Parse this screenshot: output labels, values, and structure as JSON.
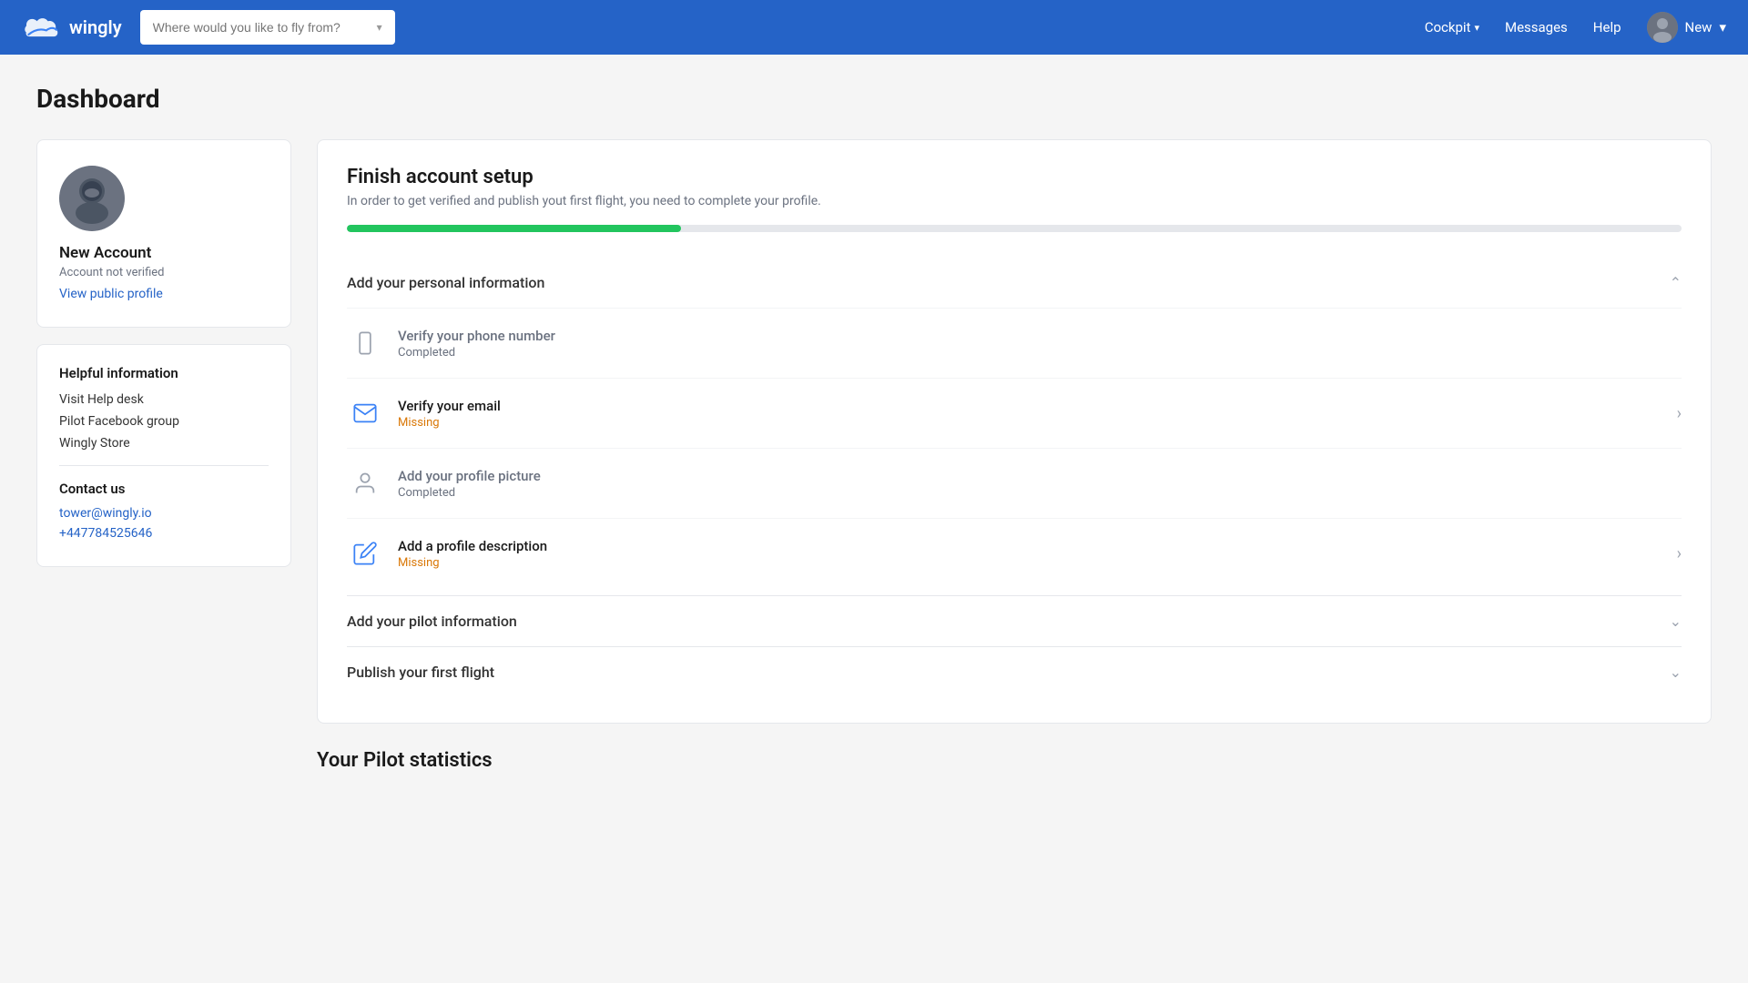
{
  "header": {
    "logo_text": "wingly",
    "search_placeholder": "Where would you like to fly from?",
    "nav_cockpit": "Cockpit",
    "nav_messages": "Messages",
    "nav_help": "Help",
    "nav_new": "New",
    "user_chevron": "▾"
  },
  "page": {
    "title": "Dashboard"
  },
  "profile": {
    "name": "New Account",
    "status": "Account not verified",
    "view_profile_link": "View public profile"
  },
  "helpful": {
    "section_title": "Helpful information",
    "links": [
      {
        "label": "Visit Help desk"
      },
      {
        "label": "Pilot Facebook group"
      },
      {
        "label": "Wingly Store"
      }
    ],
    "contact_title": "Contact us",
    "email": "tower@wingly.io",
    "phone": "+447784525646"
  },
  "setup": {
    "title": "Finish account setup",
    "subtitle": "In order to get verified and publish yout first flight, you need to complete your profile.",
    "progress_percent": 25,
    "sections": [
      {
        "id": "personal",
        "label": "Add your personal information",
        "expanded": true,
        "items": [
          {
            "id": "phone",
            "label": "Verify your phone number",
            "status": "Completed",
            "status_type": "completed",
            "has_arrow": false,
            "icon": "phone"
          },
          {
            "id": "email",
            "label": "Verify your email",
            "status": "Missing",
            "status_type": "missing",
            "has_arrow": true,
            "icon": "email"
          },
          {
            "id": "picture",
            "label": "Add your profile picture",
            "status": "Completed",
            "status_type": "completed",
            "has_arrow": false,
            "icon": "user"
          },
          {
            "id": "description",
            "label": "Add a profile description",
            "status": "Missing",
            "status_type": "missing",
            "has_arrow": true,
            "icon": "edit"
          }
        ]
      },
      {
        "id": "pilot",
        "label": "Add your pilot information",
        "expanded": false,
        "items": []
      },
      {
        "id": "flight",
        "label": "Publish your first flight",
        "expanded": false,
        "items": []
      }
    ]
  },
  "pilot_stats": {
    "title": "Your Pilot statistics"
  }
}
